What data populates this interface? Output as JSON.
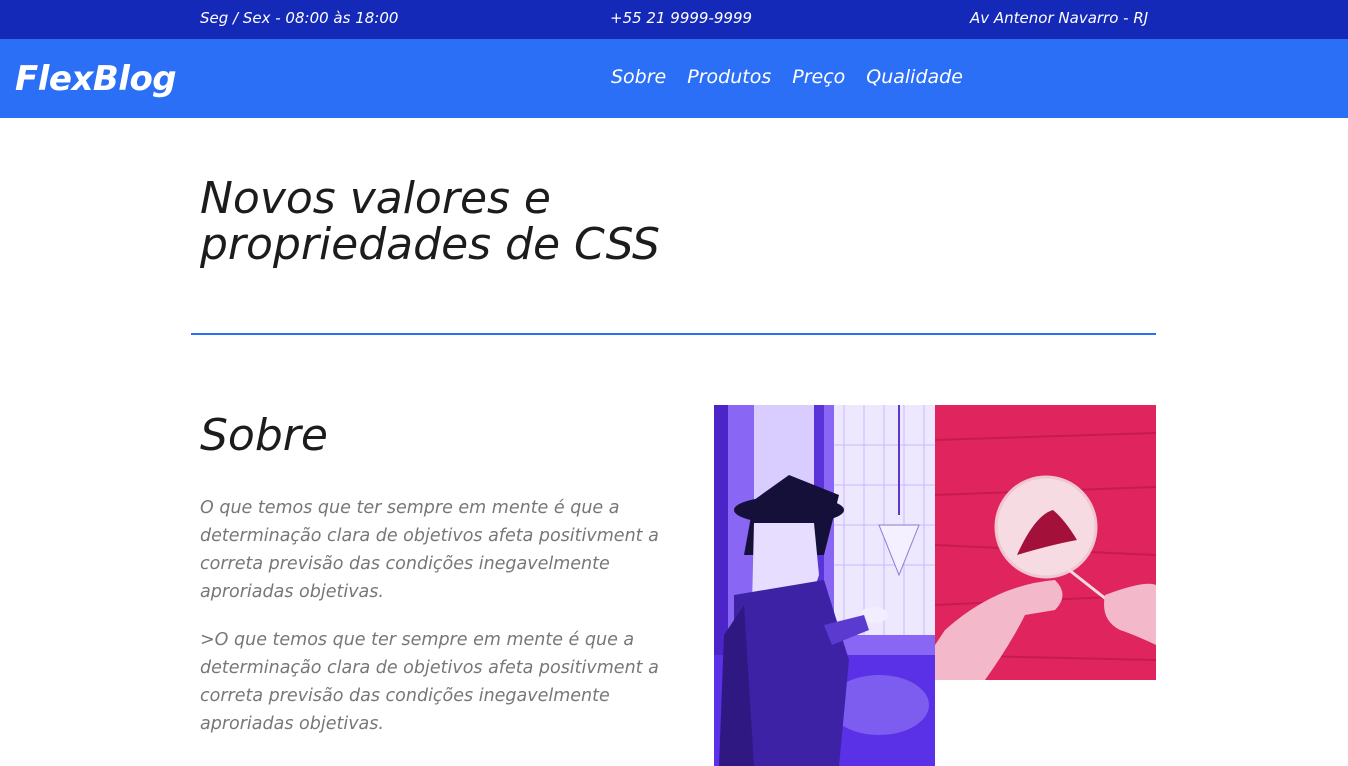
{
  "topbar": {
    "hours": "Seg / Sex - 08:00 às 18:00",
    "phone": "+55 21 9999-9999",
    "address": "Av Antenor Navarro - RJ"
  },
  "header": {
    "logo": "FlexBlog",
    "nav": [
      "Sobre",
      "Produtos",
      "Preço",
      "Qualidade"
    ]
  },
  "hero": {
    "title_line1": "Novos valores e",
    "title_line2": "propriedades de CSS"
  },
  "about": {
    "title": "Sobre",
    "paragraph1": "O que temos que ter sempre em mente é que a determinação clara de objetivos afeta positivment a correta previsão das condições inegavelmente aproriadas objetivas.",
    "paragraph2": ">O que temos que ter sempre em mente é que a determinação clara de objetivos afeta positivment a correta previsão das condições inegavelmente aproriadas objetivas."
  },
  "colors": {
    "topbar_bg": "#1429b8",
    "navbar_bg": "#2c6ff7",
    "accent": "#2c6ff7",
    "photo_purple": "#6a3df0",
    "photo_red": "#e0245e"
  },
  "images": {
    "left": "woman-with-hat-purple-photo",
    "right": "hands-painting-red-photo"
  }
}
